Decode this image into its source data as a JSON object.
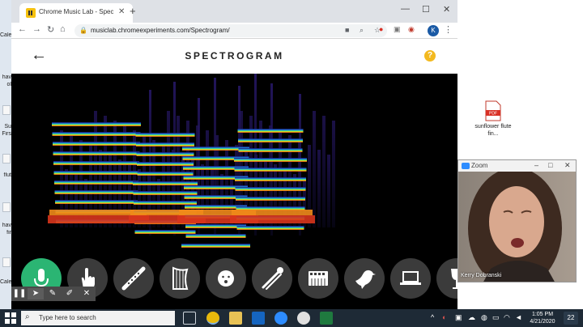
{
  "desktop": {
    "left_fragments": [
      "Cale",
      "hav",
      "ol",
      "Su",
      "Firs",
      "flut",
      "hav",
      "fir",
      "Cale"
    ],
    "pdf_file_label": "sunflower flute fin..."
  },
  "browser": {
    "tab_title": "Chrome Music Lab - Spectro",
    "tab_close": "✕",
    "new_tab": "+",
    "url": "musiclab.chromeexperiments.com/Spectrogram/",
    "profile_initial": "K",
    "win_min": "—",
    "win_max": "☐",
    "win_close": "✕"
  },
  "app": {
    "title": "SPECTROGRAM",
    "help": "?",
    "toolbar": [
      {
        "name": "microphone",
        "active": true
      },
      {
        "name": "hand",
        "active": false
      },
      {
        "name": "flute",
        "active": false
      },
      {
        "name": "harp",
        "active": false
      },
      {
        "name": "face",
        "active": false
      },
      {
        "name": "trombone",
        "active": false
      },
      {
        "name": "synth",
        "active": false
      },
      {
        "name": "bird",
        "active": false
      },
      {
        "name": "laptop",
        "active": false
      },
      {
        "name": "wine-glass",
        "active": false
      }
    ]
  },
  "zoom": {
    "title": "Zoom",
    "participant_name": "Kerry Dobranski"
  },
  "taskbar": {
    "search_placeholder": "Type here to search",
    "time": "1:05 PM",
    "date": "4/21/2020",
    "notification_count": "22"
  }
}
